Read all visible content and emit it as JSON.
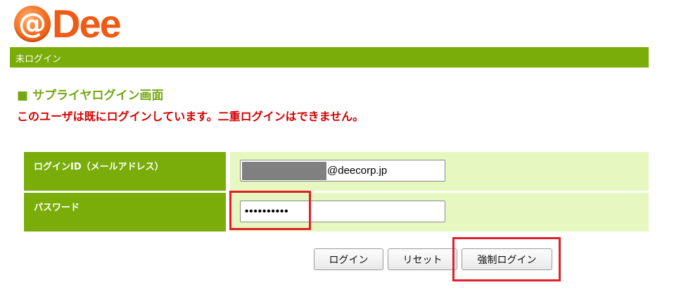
{
  "logo": {
    "at_symbol": "@",
    "brand": "Dee",
    "brand_color": "#f05a14"
  },
  "status_bar": {
    "text": "未ログイン",
    "color": "#7aad0a"
  },
  "heading": "■ サプライヤログイン画面",
  "error_message": "このユーザは既にログインしています。二重ログインはできません。",
  "form": {
    "login_id": {
      "label": "ログインID（メールアドレス）",
      "value_suffix": "@deecorp.jp"
    },
    "password": {
      "label": "パスワード",
      "masked_value": "••••••••••"
    }
  },
  "buttons": {
    "login": "ログイン",
    "reset": "リセット",
    "force_login": "強制ログイン"
  },
  "colors": {
    "accent_green": "#7aad0a",
    "field_bg": "#e6f8c0",
    "error_red": "#d40000",
    "highlight_red": "#e0202a"
  }
}
